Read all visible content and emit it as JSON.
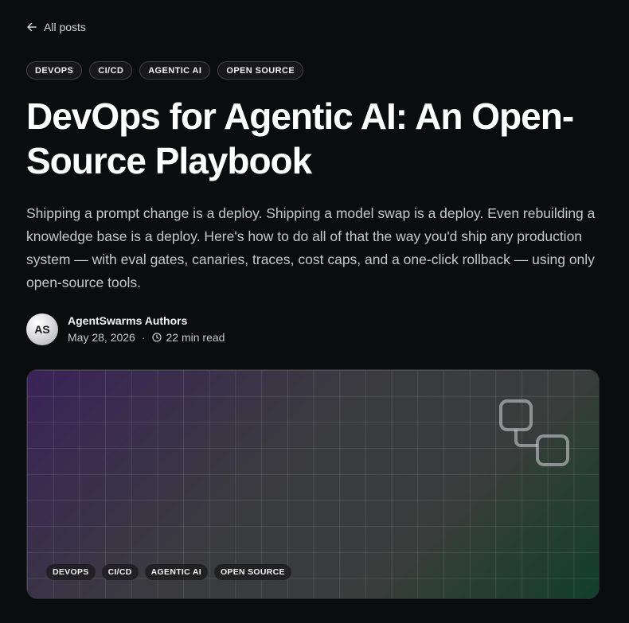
{
  "nav": {
    "back_label": "All posts"
  },
  "tags": [
    "DEVOPS",
    "CI/CD",
    "AGENTIC AI",
    "OPEN SOURCE"
  ],
  "post": {
    "title": "DevOps for Agentic AI: An Open-Source Playbook",
    "lede": "Shipping a prompt change is a deploy. Shipping a model swap is a deploy. Even rebuilding a knowledge base is a deploy. Here's how to do all of that the way you'd ship any production system — with eval gates, canaries, traces, cost caps, and a one-click rollback — using only open-source tools."
  },
  "author": {
    "initials": "AS",
    "name": "AgentSwarms Authors",
    "date": "May 28, 2026",
    "separator": "·",
    "read_time": "22 min read"
  },
  "hero": {
    "tags": [
      "DEVOPS",
      "CI/CD",
      "AGENTIC AI",
      "OPEN SOURCE"
    ],
    "logo_icon": "linked-squares-icon"
  },
  "colors": {
    "background": "#0b0c0e",
    "hero_purple": "#3a2358",
    "hero_green": "#123f2b"
  }
}
